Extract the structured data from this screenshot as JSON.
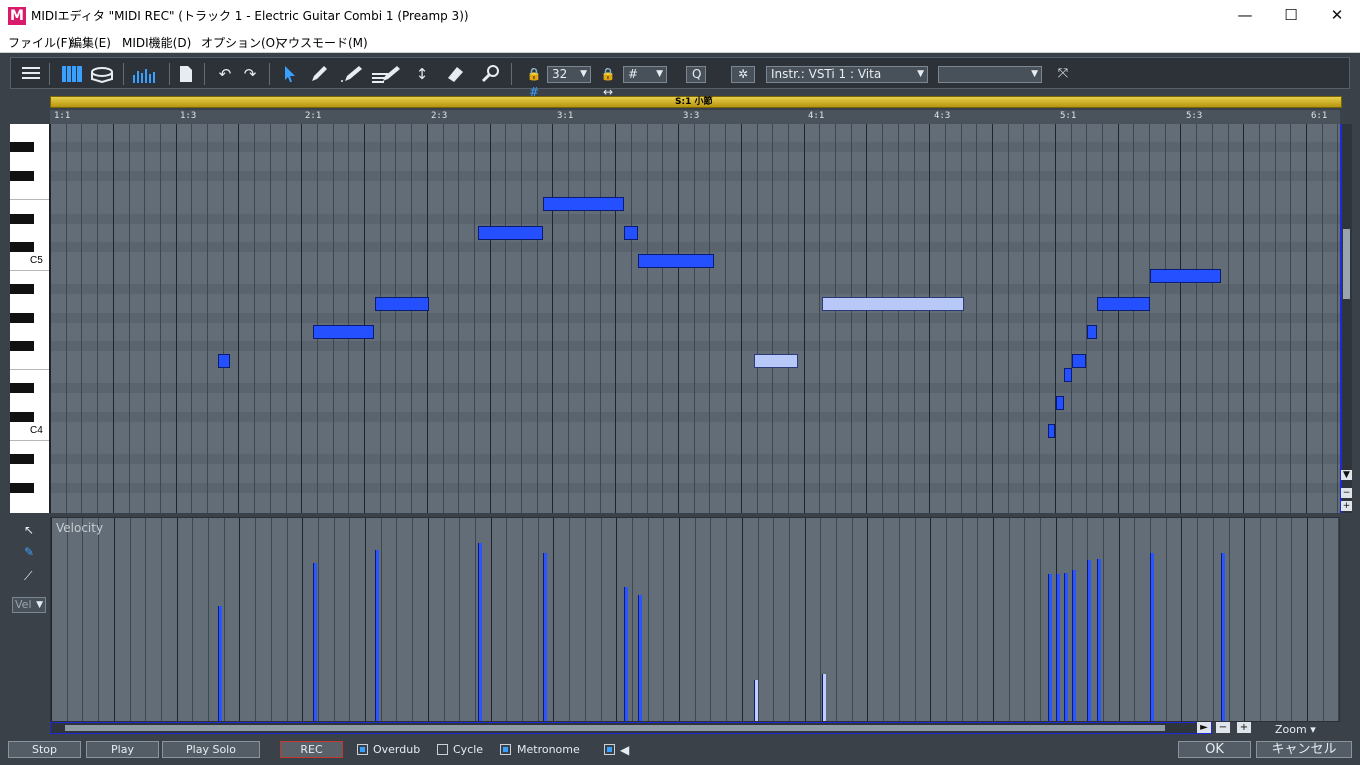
{
  "window": {
    "title": "MIDIエディタ \"MIDI REC\"  (トラック 1 - Electric Guitar Combi 1 (Preamp 3))",
    "icon_letter": "M",
    "controls": [
      "—",
      "☐",
      "✕"
    ]
  },
  "menu": [
    "ファイル(F)",
    "編集(E)",
    "MIDI機能(D)",
    "オプション(O)",
    "マウスモード(M)"
  ],
  "toolbar": {
    "grid_value": "32",
    "length_value": "#",
    "quantize_label": "Q",
    "instrument": "Instr.: VSTi 1 : Vita",
    "second_dropdown": "",
    "icons": [
      "list-icon",
      "piano-icon",
      "drum-icon",
      "levels-icon",
      "document-icon",
      "undo-icon",
      "redo-icon",
      "pointer-icon",
      "pencil-icon",
      "brush-icon",
      "multi-pencil-icon",
      "move-vertical-icon",
      "eraser-icon",
      "zoom-icon",
      "lock-grid-icon",
      "lock-length-icon",
      "settings-icon",
      "mix-icon"
    ]
  },
  "ruler": {
    "marker": "S:1  小節",
    "labels": [
      "1:1",
      "1:3",
      "2:1",
      "2:3",
      "3:1",
      "3:3",
      "4:1",
      "4:3",
      "5:1",
      "5:3",
      "6:1"
    ]
  },
  "keyboard": {
    "labels": [
      "C5",
      "C4"
    ]
  },
  "velocity": {
    "label": "Velocity",
    "mode": "Vel"
  },
  "zoom_label": "Zoom",
  "bottom": {
    "stop": "Stop",
    "play": "Play",
    "play_solo": "Play Solo",
    "rec": "REC",
    "overdub": "Overdub",
    "cycle": "Cycle",
    "metronome": "Metronome",
    "ok": "OK",
    "cancel": "キャンセル",
    "overdub_on": true,
    "cycle_on": false,
    "metronome_on": true
  },
  "colors": {
    "note": "#2450ff",
    "note_light": "#b8c8f8",
    "grid": "#636d77",
    "timeline": "#e0c23a"
  }
}
